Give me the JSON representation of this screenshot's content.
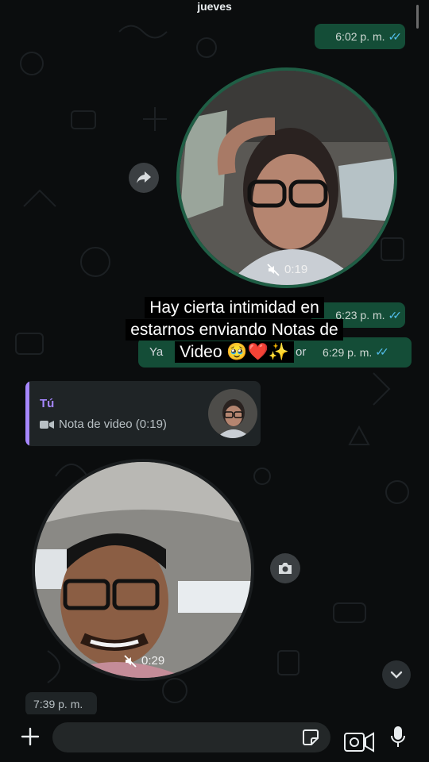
{
  "chat": {
    "date_label": "jueves",
    "msg1_time": "6:02 p. m.",
    "video1_duration": "0:19",
    "msg2_time": "6:23 p. m.",
    "msg3_text": "Ya",
    "msg3_suffix": "or",
    "msg3_time": "6:29 p. m.",
    "reply": {
      "author": "Tú",
      "body": "Nota de video (0:19)"
    },
    "video2_duration": "0:29",
    "incoming_time": "7:39 p. m."
  },
  "caption": {
    "line1": "Hay cierta intimidad en",
    "line2": "estarnos enviando Notas de",
    "line3": "Video 🥹❤️✨"
  },
  "composer": {
    "placeholder": ""
  },
  "colors": {
    "outgoing_bubble": "#144d37",
    "read_ticks": "#53bdeb",
    "reply_accent": "#a687ff",
    "video_ring": "#1f5e45"
  },
  "icons": [
    "forward-icon",
    "muted-speaker-icon",
    "video-camera-icon",
    "camera-icon",
    "chevron-down-icon",
    "plus-icon",
    "sticker-icon",
    "mic-icon"
  ]
}
